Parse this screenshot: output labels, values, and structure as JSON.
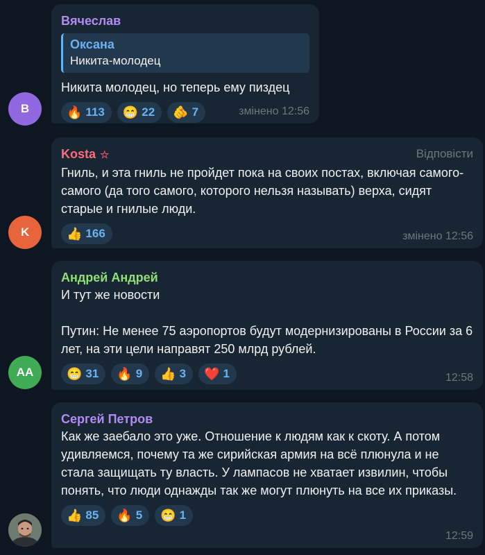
{
  "colors": {
    "background": "#0e1621",
    "bubble": "#182533",
    "accent": "#6ab2f2",
    "meta": "#6c7883"
  },
  "messages": [
    {
      "author": "Вячеслав",
      "author_color": "#b28cf3",
      "avatar_initials": "В",
      "avatar_color": "#9168e0",
      "quote": {
        "author": "Оксана",
        "text": "Никита-молодец"
      },
      "text": "Никита молодец, но теперь ему пиздец",
      "reactions": [
        {
          "emoji": "🔥",
          "icon": "fire-icon",
          "count": "113"
        },
        {
          "emoji": "😁",
          "icon": "grinning-face-icon",
          "count": "22"
        },
        {
          "emoji": "🫵",
          "icon": "pointing-hand-icon",
          "count": "7"
        }
      ],
      "meta": "змінено 12:56"
    },
    {
      "author": "Kosta",
      "author_color": "#ff6b7a",
      "star": "☆",
      "reply_label": "Відповісти",
      "avatar_initials": "K",
      "avatar_color": "#e8643a",
      "text": "Гниль, и эта гниль не пройдет пока на своих постах, включая самого-самого (да того самого, которого нельзя называть) верха, сидят старые и гнилые люди.",
      "reactions": [
        {
          "emoji": "👍",
          "icon": "thumbs-up-icon",
          "count": "166"
        }
      ],
      "meta": "змінено 12:56"
    },
    {
      "author": "Андрей Андрей",
      "author_color": "#8ee074",
      "avatar_initials": "АА",
      "avatar_color": "#3fab54",
      "text": "И тут же новости\n\nПутин: Не менее 75 аэропортов будут модернизированы в России за 6 лет, на эти цели направят 250 млрд рублей.",
      "reactions": [
        {
          "emoji": "😁",
          "icon": "grinning-face-icon",
          "count": "31"
        },
        {
          "emoji": "🔥",
          "icon": "fire-icon",
          "count": "9"
        },
        {
          "emoji": "👍",
          "icon": "thumbs-up-icon",
          "count": "3"
        },
        {
          "emoji": "❤️",
          "icon": "heart-icon",
          "count": "1"
        }
      ],
      "meta": "12:58"
    },
    {
      "author": "Сергей Петров",
      "author_color": "#b28cf3",
      "avatar_photo": true,
      "text": "Как же заебало это уже. Отношение к людям как к скоту. А потом удивляемся, почему та же сирийская армия на всё плюнула и не стала защищать ту власть. У лампасов не хватает извилин, чтобы понять, что люди однажды так же могут плюнуть на все их приказы.",
      "reactions": [
        {
          "emoji": "👍",
          "icon": "thumbs-up-icon",
          "count": "85"
        },
        {
          "emoji": "🔥",
          "icon": "fire-icon",
          "count": "5"
        },
        {
          "emoji": "😁",
          "icon": "grinning-face-icon",
          "count": "1"
        }
      ],
      "meta": "12:59"
    }
  ]
}
